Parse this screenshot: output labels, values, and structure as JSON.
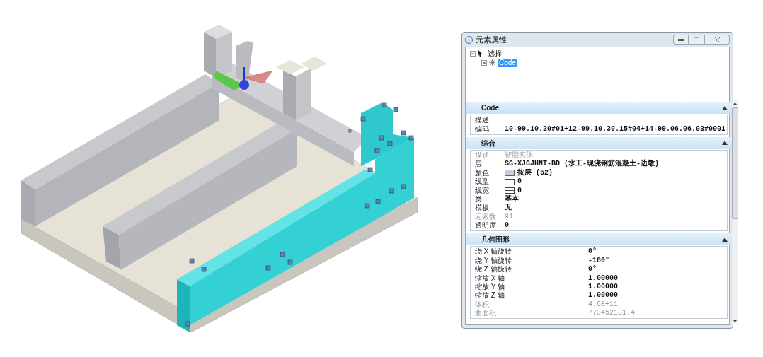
{
  "window": {
    "title": "元素属性"
  },
  "tree": [
    {
      "label": "选择",
      "expanded": true,
      "selected": false,
      "children": [
        {
          "label": "Code",
          "expanded": false,
          "selected": true
        }
      ]
    }
  ],
  "sections": [
    {
      "title": "Code",
      "expanded": true,
      "rows": [
        {
          "label": "描述",
          "kind": "text",
          "disabled": false
        },
        {
          "label": "编码",
          "value": "10-99.10.20#01+12-99.10.30.15#04+14-99.06.06.03#0001",
          "kind": "text",
          "disabled": false
        }
      ]
    },
    {
      "title": "综合",
      "expanded": true,
      "rows": [
        {
          "label": "描述",
          "value": "智能实体",
          "kind": "text",
          "disabled": true
        },
        {
          "label": "层",
          "value": "SG-XJGJHNT-BD (水工-现浇钢筋混凝土-边墩)",
          "kind": "text",
          "disabled": false
        },
        {
          "label": "颜色",
          "value": "按层 (52)",
          "kind": "color",
          "disabled": false
        },
        {
          "label": "线型",
          "value": "0",
          "kind": "line",
          "disabled": false
        },
        {
          "label": "线宽",
          "value": "0",
          "kind": "line",
          "disabled": false
        },
        {
          "label": "类",
          "value": "基本",
          "kind": "text",
          "disabled": false
        },
        {
          "label": "模板",
          "value": "无",
          "kind": "text",
          "disabled": false
        },
        {
          "label": "元素数",
          "value": "91",
          "kind": "text",
          "disabled": true
        },
        {
          "label": "透明度",
          "value": "0",
          "kind": "text",
          "disabled": false
        }
      ]
    },
    {
      "title": "几何图形",
      "expanded": true,
      "rows": [
        {
          "label": "绕 X 轴旋转",
          "value": "0°",
          "kind": "text",
          "disabled": false
        },
        {
          "label": "绕 Y 轴旋转",
          "value": "-180°",
          "kind": "text",
          "disabled": false
        },
        {
          "label": "绕 Z 轴旋转",
          "value": "0°",
          "kind": "text",
          "disabled": false
        },
        {
          "label": "缩放 X 轴",
          "value": "1.00000",
          "kind": "text",
          "disabled": false
        },
        {
          "label": "缩放 Y 轴",
          "value": "1.00000",
          "kind": "text",
          "disabled": false
        },
        {
          "label": "缩放 Z 轴",
          "value": "1.00000",
          "kind": "text",
          "disabled": false
        },
        {
          "label": "体积",
          "value": "4.6E+11",
          "kind": "text",
          "disabled": true
        },
        {
          "label": "曲面积",
          "value": "773452181.4",
          "kind": "text",
          "disabled": true
        }
      ]
    }
  ]
}
